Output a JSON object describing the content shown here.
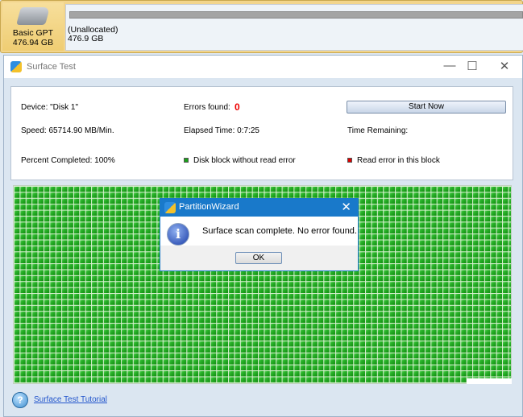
{
  "disk": {
    "type": "Basic GPT",
    "size": "476.94 GB",
    "partition_label": "(Unallocated)",
    "partition_size": "476.9 GB"
  },
  "window": {
    "title": "Surface Test",
    "minimize": "—",
    "maximize": "☐",
    "close": "✕"
  },
  "info": {
    "device": "Device:  \"Disk 1\"",
    "errors_label": "Errors found:",
    "errors_value": "0",
    "start_button": "Start Now",
    "speed": "Speed:  65714.90 MB/Min.",
    "elapsed": "Elapsed Time:  0:7:25",
    "remaining": "Time Remaining:",
    "percent": "Percent Completed:  100%",
    "legend_ok": "Disk block without read error",
    "legend_err": "Read error in this block",
    "progress_percent": 100
  },
  "colors": {
    "ok": "#19a219",
    "error": "#dd0000"
  },
  "help": {
    "icon": "?",
    "link": "Surface Test Tutorial"
  },
  "dialog": {
    "title": "PartitionWizard",
    "close": "✕",
    "icon": "i",
    "message": "Surface scan complete. No error found.",
    "ok": "OK"
  }
}
